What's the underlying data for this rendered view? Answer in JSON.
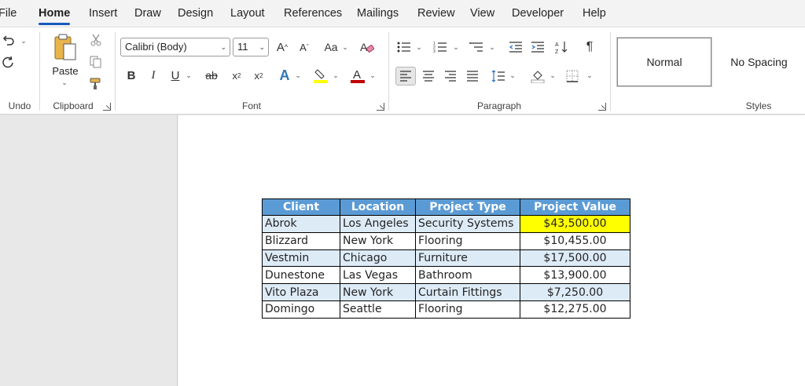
{
  "menu": {
    "items": [
      "File",
      "Home",
      "Insert",
      "Draw",
      "Design",
      "Layout",
      "References",
      "Mailings",
      "Review",
      "View",
      "Developer",
      "Help"
    ],
    "active": "Home"
  },
  "ribbon": {
    "undo": {
      "label": "Undo"
    },
    "clipboard": {
      "label": "Clipboard",
      "paste_label": "Paste"
    },
    "font": {
      "label": "Font",
      "font_name": "Calibri (Body)",
      "font_size": "11"
    },
    "paragraph": {
      "label": "Paragraph"
    },
    "styles": {
      "label": "Styles",
      "normal": "Normal",
      "no_spacing": "No Spacing"
    }
  },
  "table": {
    "headers": [
      "Client",
      "Location",
      "Project Type",
      "Project Value"
    ],
    "rows": [
      [
        "Abrok",
        "Los Angeles",
        "Security Systems",
        "$43,500.00"
      ],
      [
        "Blizzard",
        "New York",
        "Flooring",
        "$10,455.00"
      ],
      [
        "Vestmin",
        "Chicago",
        "Furniture",
        "$17,500.00"
      ],
      [
        "Dunestone",
        "Las Vegas",
        "Bathroom",
        "$13,900.00"
      ],
      [
        "Vito Plaza",
        "New York",
        "Curtain Fittings",
        "$7,250.00"
      ],
      [
        "Domingo",
        "Seattle",
        "Flooring",
        "$12,275.00"
      ]
    ],
    "header_color": "#5B9BD5",
    "band_color": "#DDEBF7",
    "highlight_color": "#FFFF00"
  }
}
